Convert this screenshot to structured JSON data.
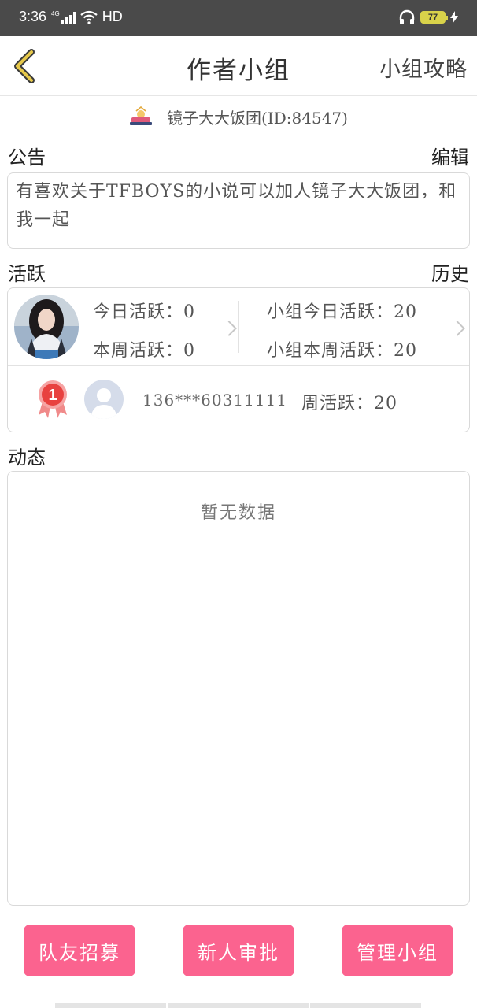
{
  "status_bar": {
    "time": "3:36",
    "network": "4G",
    "hd": "HD",
    "battery": "77",
    "colors": {
      "bg": "#4a4a4a",
      "battery": "#d8d24a"
    }
  },
  "nav": {
    "title": "作者小组",
    "right_link": "小组攻略",
    "back_icon": "chevron-left-icon"
  },
  "group": {
    "name": "镜子大大饭团(ID:84547)",
    "icon": "group-crown-icon"
  },
  "notice": {
    "heading": "公告",
    "edit_label": "编辑",
    "text": "有喜欢关于TFBOYS的小说可以加人镜子大大饭团，和我一起"
  },
  "activity": {
    "heading": "活跃",
    "history_label": "历史",
    "my_today": "今日活跃：0",
    "my_week": "本周活跃：0",
    "group_today": "小组今日活跃：20",
    "group_week": "小组本周活跃：20",
    "ranking": [
      {
        "rank": "1",
        "user": "136***60311111",
        "weekly": "周活跃：20"
      }
    ]
  },
  "feed": {
    "heading": "动态",
    "empty_text": "暂无数据"
  },
  "actions": {
    "recruit": "队友招募",
    "approve": "新人审批",
    "manage": "管理小组"
  },
  "theme": {
    "accent": "#fb638f",
    "back_icon_color": "#e6c84a"
  }
}
